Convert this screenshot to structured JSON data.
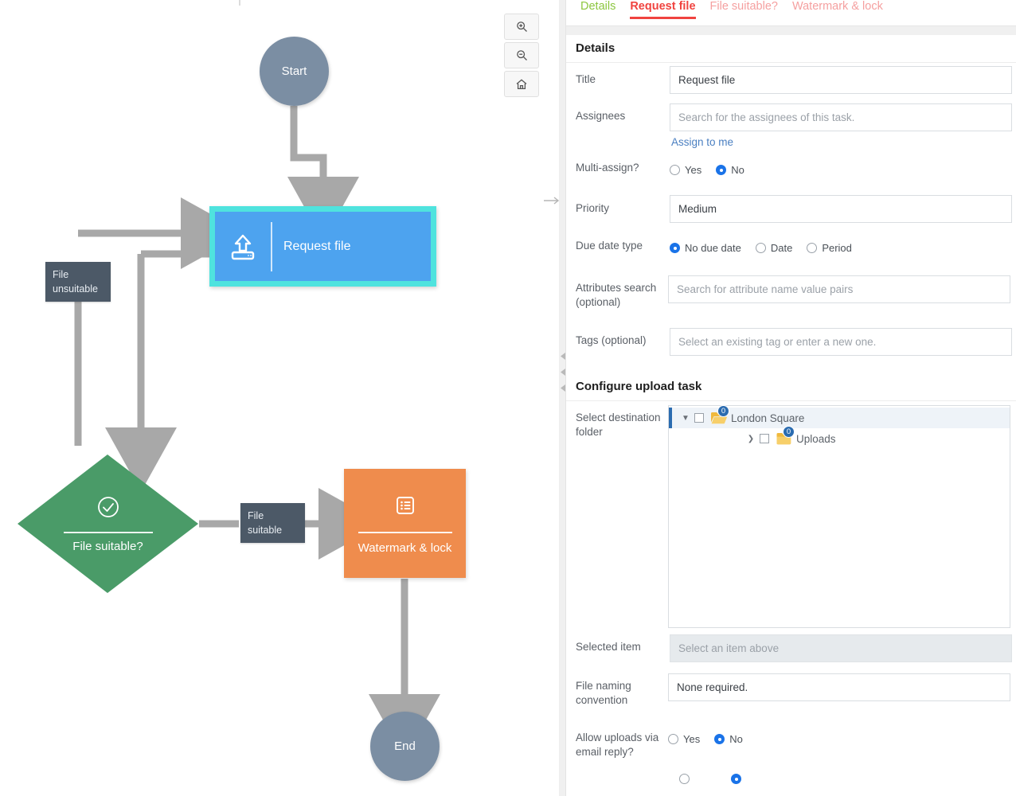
{
  "flowchart": {
    "zoom_controls": [
      {
        "name": "zoom-in-button",
        "icon": "magnifier-plus-icon"
      },
      {
        "name": "zoom-out-button",
        "icon": "magnifier-minus-icon"
      },
      {
        "name": "reset-view-button",
        "icon": "home-icon"
      }
    ],
    "nodes": {
      "start": {
        "label": "Start",
        "color": "#7b8ea3"
      },
      "request_file": {
        "label": "Request file",
        "icon": "upload-icon",
        "color": "#4da3ef",
        "selection_color": "#4fe3de"
      },
      "decision": {
        "label": "File suitable?",
        "icon": "check-circle-icon",
        "color": "#4a9b68"
      },
      "watermark": {
        "label": "Watermark & lock",
        "icon": "list-icon",
        "color": "#ef8c4d"
      },
      "end": {
        "label": "End",
        "color": "#7b8ea3"
      }
    },
    "edge_labels": {
      "unsuitable": "File\nunsuitable",
      "suitable": "File\nsuitable"
    },
    "edge_label_color": "#4c5967"
  },
  "panel": {
    "tabs": [
      {
        "label": "Details",
        "state": "complete"
      },
      {
        "label": "Request file",
        "state": "active"
      },
      {
        "label": "File suitable?",
        "state": "incomplete"
      },
      {
        "label": "Watermark & lock",
        "state": "incomplete"
      }
    ],
    "accent_active": "#f0433f",
    "accent_complete": "#8cc63f",
    "sections": {
      "details": {
        "title": "Details",
        "title_field": {
          "label": "Title",
          "value": "Request file"
        },
        "assignees": {
          "label": "Assignees",
          "placeholder": "Search for the assignees of this task.",
          "assign_link": "Assign to me"
        },
        "multi_assign": {
          "label": "Multi-assign?",
          "options": [
            "Yes",
            "No"
          ],
          "selected": "No"
        },
        "priority": {
          "label": "Priority",
          "value": "Medium"
        },
        "due_date_type": {
          "label": "Due date type",
          "options": [
            "No due date",
            "Date",
            "Period"
          ],
          "selected": "No due date"
        },
        "attributes_search": {
          "label": "Attributes search (optional)",
          "placeholder": "Search for attribute name value pairs"
        },
        "tags": {
          "label": "Tags (optional)",
          "placeholder": "Select an existing tag or enter a new one."
        }
      },
      "upload": {
        "title": "Configure upload task",
        "destination": {
          "label": "Select destination folder",
          "tree": [
            {
              "name": "London Square",
              "badge": "0",
              "expanded": true,
              "checked": false,
              "depth": 0,
              "selected": true
            },
            {
              "name": "Uploads",
              "badge": "0",
              "expanded": false,
              "checked": false,
              "depth": 1,
              "selected": false
            }
          ]
        },
        "selected_item": {
          "label": "Selected item",
          "placeholder": "Select an item above",
          "disabled": true
        },
        "file_naming": {
          "label": "File naming convention",
          "value": "None required."
        },
        "email_uploads": {
          "label": "Allow uploads via email reply?",
          "options": [
            "Yes",
            "No"
          ],
          "selected": "No"
        }
      }
    }
  }
}
